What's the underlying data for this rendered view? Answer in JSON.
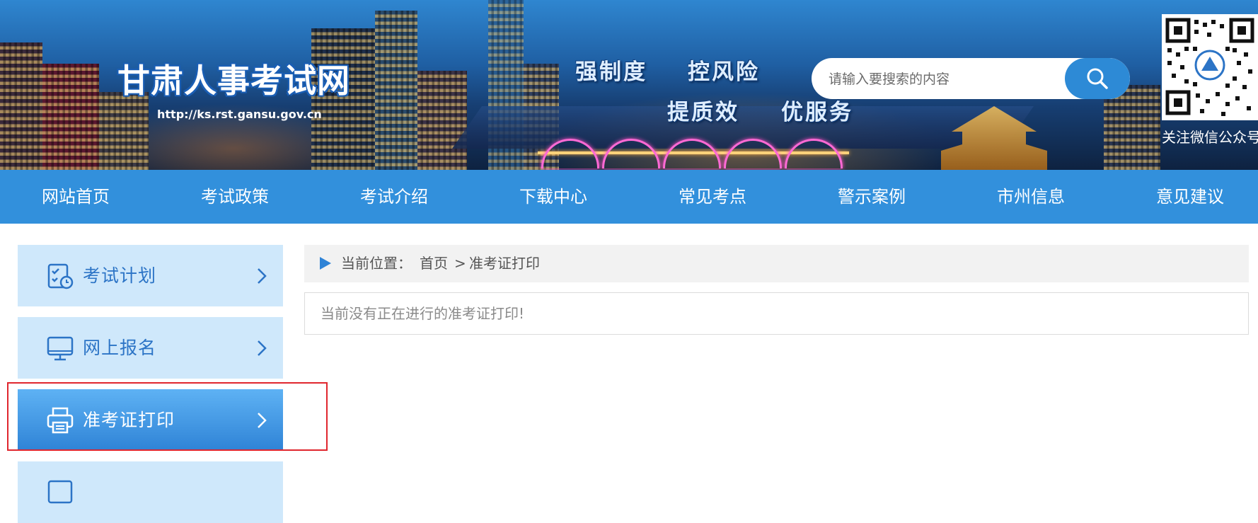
{
  "header": {
    "site_title": "甘肃人事考试网",
    "site_url": "http://ks.rst.gansu.gov.cn",
    "slogans": [
      "强制度",
      "控风险",
      "提质效",
      "优服务"
    ],
    "search": {
      "placeholder": "请输入要搜索的内容",
      "value": "",
      "button_icon": "search-icon"
    },
    "qr_label": "关注微信公众号"
  },
  "nav": {
    "items": [
      "网站首页",
      "考试政策",
      "考试介绍",
      "下载中心",
      "常见考点",
      "警示案例",
      "市州信息",
      "意见建议"
    ]
  },
  "sidebar": {
    "items": [
      {
        "label": "考试计划",
        "icon": "exam-plan-icon",
        "active": false
      },
      {
        "label": "网上报名",
        "icon": "monitor-icon",
        "active": false
      },
      {
        "label": "准考证打印",
        "icon": "printer-icon",
        "active": true
      },
      {
        "label": "",
        "icon": "sidebar-icon",
        "active": false
      }
    ]
  },
  "breadcrumb": {
    "prefix": "当前位置：",
    "home": "首页",
    "separator": ">",
    "current": "准考证打印"
  },
  "main": {
    "notice": "当前没有正在进行的准考证打印!"
  },
  "colors": {
    "nav_bg": "#3290dc",
    "sidebar_bg": "#cfe8fb",
    "sidebar_active": "#2f83d6",
    "accent_text": "#2c74c6",
    "highlight_border": "#e0262e"
  }
}
